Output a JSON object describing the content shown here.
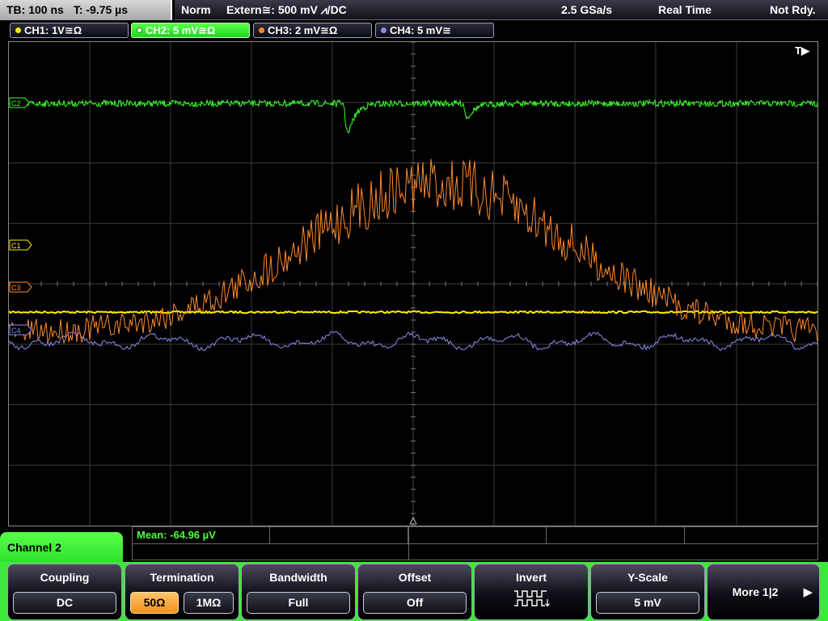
{
  "timebase": {
    "tb": "TB: 100 ns",
    "t": "T: -9.75 µs"
  },
  "status": {
    "mode": "Norm",
    "trigger": "Extern≅: 500 mV ⩘/DC",
    "sample_rate": "2.5 GSa/s",
    "acq": "Real Time",
    "state": "Not Rdy."
  },
  "channels": [
    {
      "label": "CH1: 1V≅Ω",
      "color": "#ffee00"
    },
    {
      "label": "CH2: 5 mV≅Ω",
      "color": "#3cff2c"
    },
    {
      "label": "CH3: 2 mV≅Ω",
      "color": "#ff8a2a"
    },
    {
      "label": "CH4: 5 mV≅",
      "color": "#8c8cf0"
    }
  ],
  "markers": {
    "c1": "C1",
    "c2": "C2",
    "c3": "C3",
    "c4": "C4",
    "trigger": "T▶"
  },
  "measurement": {
    "mean": "Mean: -64.96 µV"
  },
  "menu": {
    "title": "Channel 2",
    "coupling": {
      "title": "Coupling",
      "value": "DC"
    },
    "termination": {
      "title": "Termination",
      "opt1": "50Ω",
      "opt2": "1MΩ"
    },
    "bandwidth": {
      "title": "Bandwidth",
      "value": "Full"
    },
    "offset": {
      "title": "Offset",
      "value": "Off"
    },
    "invert": {
      "title": "Invert"
    },
    "yscale": {
      "title": "Y-Scale",
      "value": "5 mV"
    },
    "more": "More 1|2",
    "more_arrow": "▶"
  }
}
